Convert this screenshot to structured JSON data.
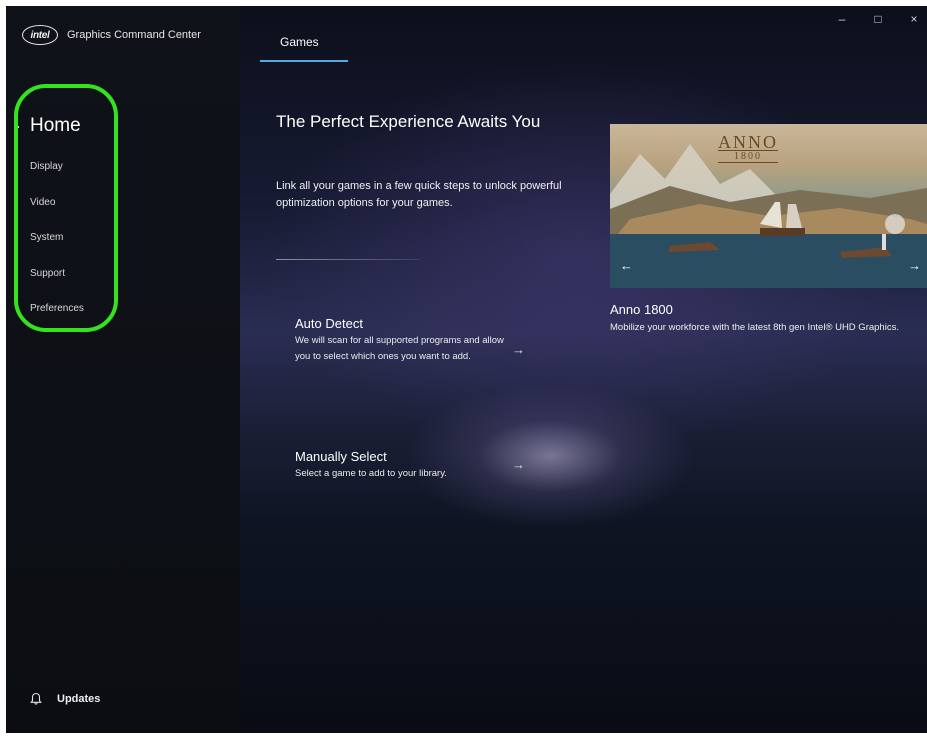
{
  "app": {
    "logo_text": "intel",
    "title": "Graphics Command Center"
  },
  "sidebar": {
    "home_label": "Home",
    "items": [
      {
        "label": "Display"
      },
      {
        "label": "Video"
      },
      {
        "label": "System"
      },
      {
        "label": "Support"
      },
      {
        "label": "Preferences"
      }
    ],
    "updates_label": "Updates",
    "updates_icon": "bell-icon"
  },
  "tabs": [
    {
      "label": "Games",
      "active": true
    }
  ],
  "window_controls": {
    "minimize": "–",
    "maximize": "□",
    "close": "×"
  },
  "hero": {
    "title": "The Perfect Experience Awaits You",
    "description": "Link all your games in a few quick steps to unlock powerful optimization options for your games."
  },
  "actions": [
    {
      "title": "Auto Detect",
      "description": "We will scan for all supported programs and allow you to select which ones you want to add.",
      "arrow": "→"
    },
    {
      "title": "Manually Select",
      "description": "Select a game to add to your library.",
      "arrow": "→"
    }
  ],
  "feature": {
    "image_logo_line1": "ANNO",
    "image_logo_line2": "1800",
    "prev_arrow": "←",
    "next_arrow": "→",
    "title": "Anno 1800",
    "description": "Mobilize your workforce with the latest 8th gen Intel® UHD Graphics."
  },
  "colors": {
    "highlight_ring": "#33e31d",
    "tab_underline": "#5aa7e6"
  }
}
